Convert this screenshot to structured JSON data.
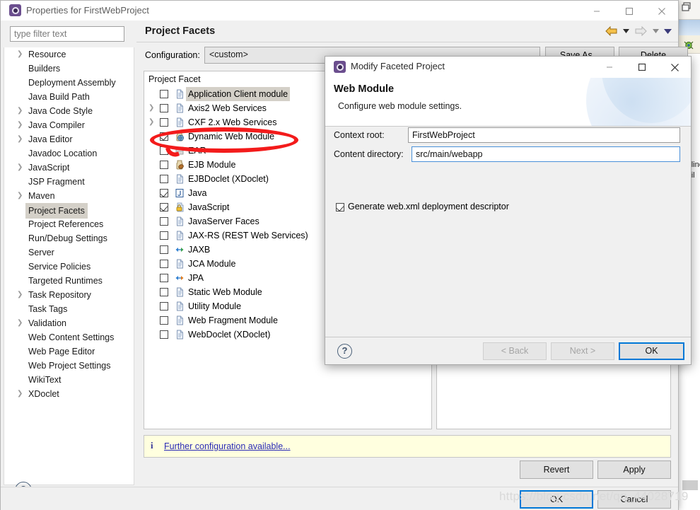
{
  "background": {
    "outline_text": "Outline\navail"
  },
  "properties_window": {
    "title": "Properties for FirstWebProject",
    "window_controls": [
      "minimize",
      "maximize",
      "close"
    ],
    "filter": {
      "placeholder": "type filter text",
      "value": ""
    },
    "nav_items": [
      {
        "label": "Resource",
        "expandable": true,
        "selected": false
      },
      {
        "label": "Builders",
        "expandable": false,
        "selected": false
      },
      {
        "label": "Deployment Assembly",
        "expandable": false,
        "selected": false
      },
      {
        "label": "Java Build Path",
        "expandable": false,
        "selected": false
      },
      {
        "label": "Java Code Style",
        "expandable": true,
        "selected": false
      },
      {
        "label": "Java Compiler",
        "expandable": true,
        "selected": false
      },
      {
        "label": "Java Editor",
        "expandable": true,
        "selected": false
      },
      {
        "label": "Javadoc Location",
        "expandable": false,
        "selected": false
      },
      {
        "label": "JavaScript",
        "expandable": true,
        "selected": false
      },
      {
        "label": "JSP Fragment",
        "expandable": false,
        "selected": false
      },
      {
        "label": "Maven",
        "expandable": true,
        "selected": false
      },
      {
        "label": "Project Facets",
        "expandable": false,
        "selected": true
      },
      {
        "label": "Project References",
        "expandable": false,
        "selected": false
      },
      {
        "label": "Run/Debug Settings",
        "expandable": false,
        "selected": false
      },
      {
        "label": "Server",
        "expandable": false,
        "selected": false
      },
      {
        "label": "Service Policies",
        "expandable": false,
        "selected": false
      },
      {
        "label": "Targeted Runtimes",
        "expandable": false,
        "selected": false
      },
      {
        "label": "Task Repository",
        "expandable": true,
        "selected": false
      },
      {
        "label": "Task Tags",
        "expandable": false,
        "selected": false
      },
      {
        "label": "Validation",
        "expandable": true,
        "selected": false
      },
      {
        "label": "Web Content Settings",
        "expandable": false,
        "selected": false
      },
      {
        "label": "Web Page Editor",
        "expandable": false,
        "selected": false
      },
      {
        "label": "Web Project Settings",
        "expandable": false,
        "selected": false
      },
      {
        "label": "WikiText",
        "expandable": false,
        "selected": false
      },
      {
        "label": "XDoclet",
        "expandable": true,
        "selected": false
      }
    ],
    "page_title": "Project Facets",
    "toolbar": {
      "back_icon": "back-arrow-icon",
      "back_menu_icon": "chevron-down-icon",
      "forward_icon": "forward-arrow-icon",
      "forward_menu_icon": "chevron-down-icon",
      "more_icon": "chevron-down-icon"
    },
    "configuration": {
      "label": "Configuration:",
      "value": "<custom>",
      "save_as_label": "Save As...",
      "delete_label": "Delete"
    },
    "facet_table": {
      "header": "Project Facet",
      "rows": [
        {
          "label": "Application Client module",
          "checked": false,
          "expandable": false,
          "highlighted": true,
          "icon": "document-icon"
        },
        {
          "label": "Axis2 Web Services",
          "checked": false,
          "expandable": true,
          "highlighted": false,
          "icon": "document-icon"
        },
        {
          "label": "CXF 2.x Web Services",
          "checked": false,
          "expandable": true,
          "highlighted": false,
          "icon": "document-icon"
        },
        {
          "label": "Dynamic Web Module",
          "checked": true,
          "expandable": false,
          "highlighted": false,
          "icon": "web-module-icon"
        },
        {
          "label": "EAR",
          "checked": false,
          "expandable": false,
          "highlighted": false,
          "icon": "ear-icon"
        },
        {
          "label": "EJB Module",
          "checked": false,
          "expandable": false,
          "highlighted": false,
          "icon": "ejb-icon"
        },
        {
          "label": "EJBDoclet (XDoclet)",
          "checked": false,
          "expandable": false,
          "highlighted": false,
          "icon": "document-icon"
        },
        {
          "label": "Java",
          "checked": true,
          "expandable": false,
          "highlighted": false,
          "icon": "java-icon"
        },
        {
          "label": "JavaScript",
          "checked": true,
          "expandable": false,
          "highlighted": false,
          "icon": "javascript-icon"
        },
        {
          "label": "JavaServer Faces",
          "checked": false,
          "expandable": false,
          "highlighted": false,
          "icon": "document-icon"
        },
        {
          "label": "JAX-RS (REST Web Services)",
          "checked": false,
          "expandable": false,
          "highlighted": false,
          "icon": "document-icon"
        },
        {
          "label": "JAXB",
          "checked": false,
          "expandable": false,
          "highlighted": false,
          "icon": "binding-icon"
        },
        {
          "label": "JCA Module",
          "checked": false,
          "expandable": false,
          "highlighted": false,
          "icon": "document-icon"
        },
        {
          "label": "JPA",
          "checked": false,
          "expandable": false,
          "highlighted": false,
          "icon": "jpa-icon"
        },
        {
          "label": "Static Web Module",
          "checked": false,
          "expandable": false,
          "highlighted": false,
          "icon": "document-icon"
        },
        {
          "label": "Utility Module",
          "checked": false,
          "expandable": false,
          "highlighted": false,
          "icon": "document-icon"
        },
        {
          "label": "Web Fragment Module",
          "checked": false,
          "expandable": false,
          "highlighted": false,
          "icon": "document-icon"
        },
        {
          "label": "WebDoclet (XDoclet)",
          "checked": false,
          "expandable": false,
          "highlighted": false,
          "icon": "document-icon"
        }
      ]
    },
    "info_bar": {
      "icon": "info-icon",
      "link_text": "Further configuration available..."
    },
    "revert_label": "Revert",
    "apply_label": "Apply",
    "ok_label": "OK",
    "cancel_label": "Cancel",
    "help_icon": "help-icon"
  },
  "modal": {
    "title": "Modify Faceted Project",
    "window_controls": [
      "minimize",
      "maximize",
      "close"
    ],
    "heading": "Web Module",
    "subheading": "Configure web module settings.",
    "fields": [
      {
        "label": "Context root:",
        "value": "FirstWebProject",
        "focused": false
      },
      {
        "label": "Content directory:",
        "value": "src/main/webapp",
        "focused": true
      }
    ],
    "checkbox": {
      "label": "Generate web.xml deployment descriptor",
      "checked": true
    },
    "help_icon": "help-icon",
    "buttons": [
      {
        "label": "< Back",
        "disabled": true,
        "default": false
      },
      {
        "label": "Next >",
        "disabled": true,
        "default": false
      },
      {
        "label": "OK",
        "disabled": false,
        "default": true
      }
    ]
  },
  "annotation": {
    "shape": "red-ellipse",
    "color": "#f31b1b",
    "targets": "Dynamic Web Module"
  },
  "watermark": {
    "text": "https://blog.csdn.net/qq_44028719"
  }
}
